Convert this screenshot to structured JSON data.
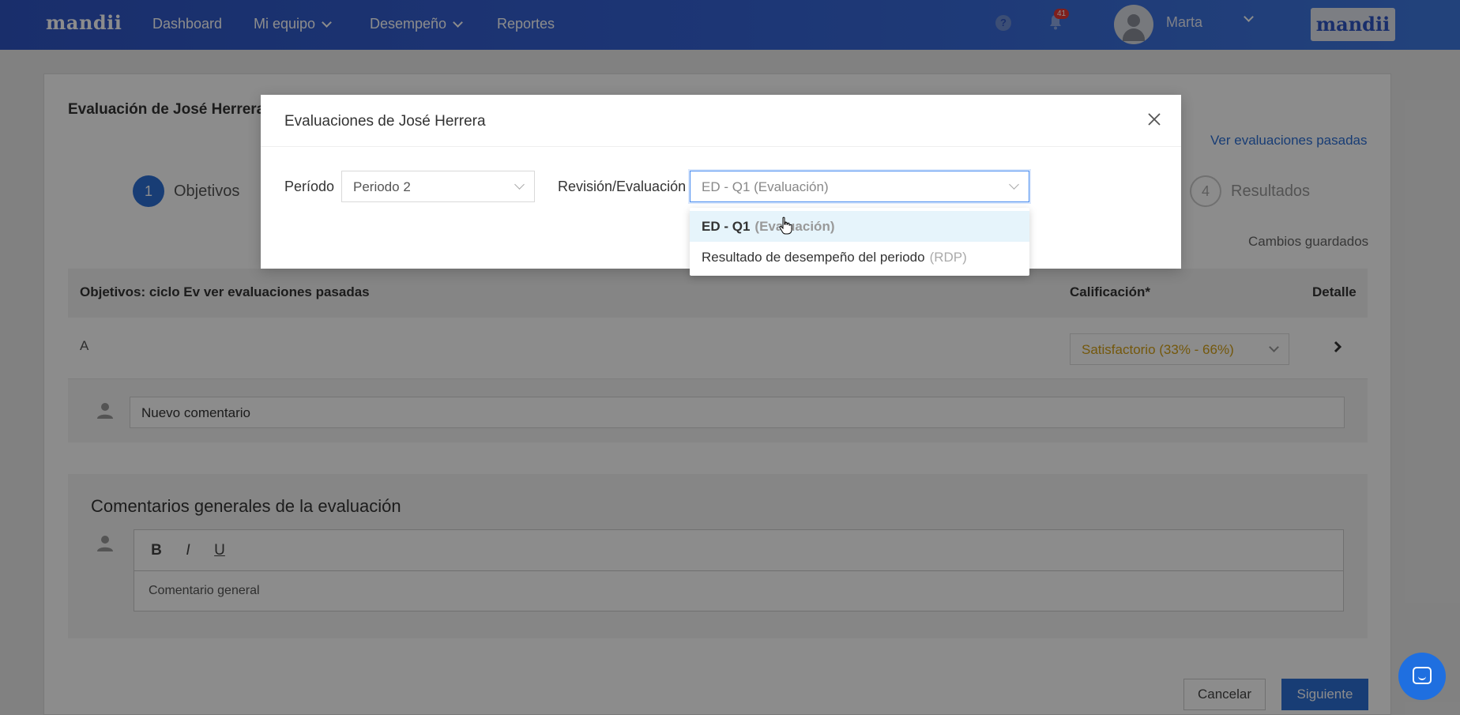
{
  "nav": {
    "brand": "mandii",
    "items": [
      {
        "label": "Dashboard"
      },
      {
        "label": "Mi equipo"
      },
      {
        "label": "Desempeño"
      },
      {
        "label": "Reportes"
      }
    ],
    "notification_count": "41",
    "help_glyph": "?",
    "user_name": "Marta",
    "company_logo": "mandii"
  },
  "page": {
    "title": "Evaluación de José Herrera",
    "past_link": "Ver evaluaciones pasadas",
    "steps": [
      {
        "number": "1",
        "label": "Objetivos"
      },
      {
        "number": "4",
        "label": "Resultados"
      }
    ],
    "saved_status": "Cambios guardados",
    "table": {
      "headers": [
        "Objetivos: ciclo Ev ver evaluaciones pasadas",
        "Calificación*",
        "Detalle"
      ],
      "rows": [
        {
          "objective": "A",
          "grade": "Satisfactorio (33% - 66%)"
        }
      ]
    },
    "comment_placeholder": "Nuevo comentario",
    "general": {
      "heading": "Comentarios generales de la evaluación",
      "toolbar": [
        "B",
        "I",
        "U"
      ],
      "text": "Comentario general"
    },
    "cancel_label": "Cancelar",
    "next_label": "Siguiente"
  },
  "modal": {
    "title": "Evaluaciones de José Herrera",
    "close_glyph": "X",
    "period_label": "Período",
    "period_value": "Periodo 2",
    "review_label": "Revisión/Evaluación",
    "review_value": "ED - Q1 (Evaluación)",
    "options": [
      {
        "main": "ED - Q1",
        "sub": "(Evaluación)",
        "active": true
      },
      {
        "main": "Resultado de desempeño del periodo",
        "sub": "(RDP)",
        "active": false
      }
    ]
  },
  "colors": {
    "nav_start": "#2f55c4",
    "nav_end": "#3f79e1",
    "primary": "#2c6fd6",
    "grade_text": "#d4a017",
    "option_highlight": "#e6f4fb"
  }
}
